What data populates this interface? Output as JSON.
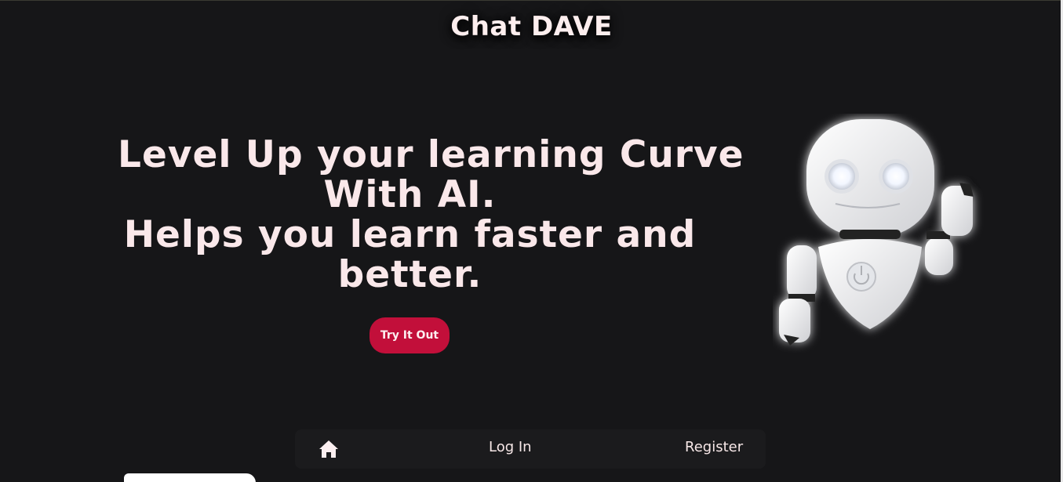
{
  "header": {
    "brand": "Chat DAVE"
  },
  "hero": {
    "lines": [
      "Level Up your learning Curve",
      "With AI.",
      "Helps you learn faster and",
      "better."
    ],
    "cta_label": "Try It Out"
  },
  "navbar": {
    "home_icon": "home-icon",
    "login_label": "Log In",
    "register_label": "Register"
  },
  "colors": {
    "background": "#161618",
    "accent": "#c20f3a",
    "text": "#fae8ea"
  },
  "icons": {
    "robot": "robot-illustration"
  }
}
